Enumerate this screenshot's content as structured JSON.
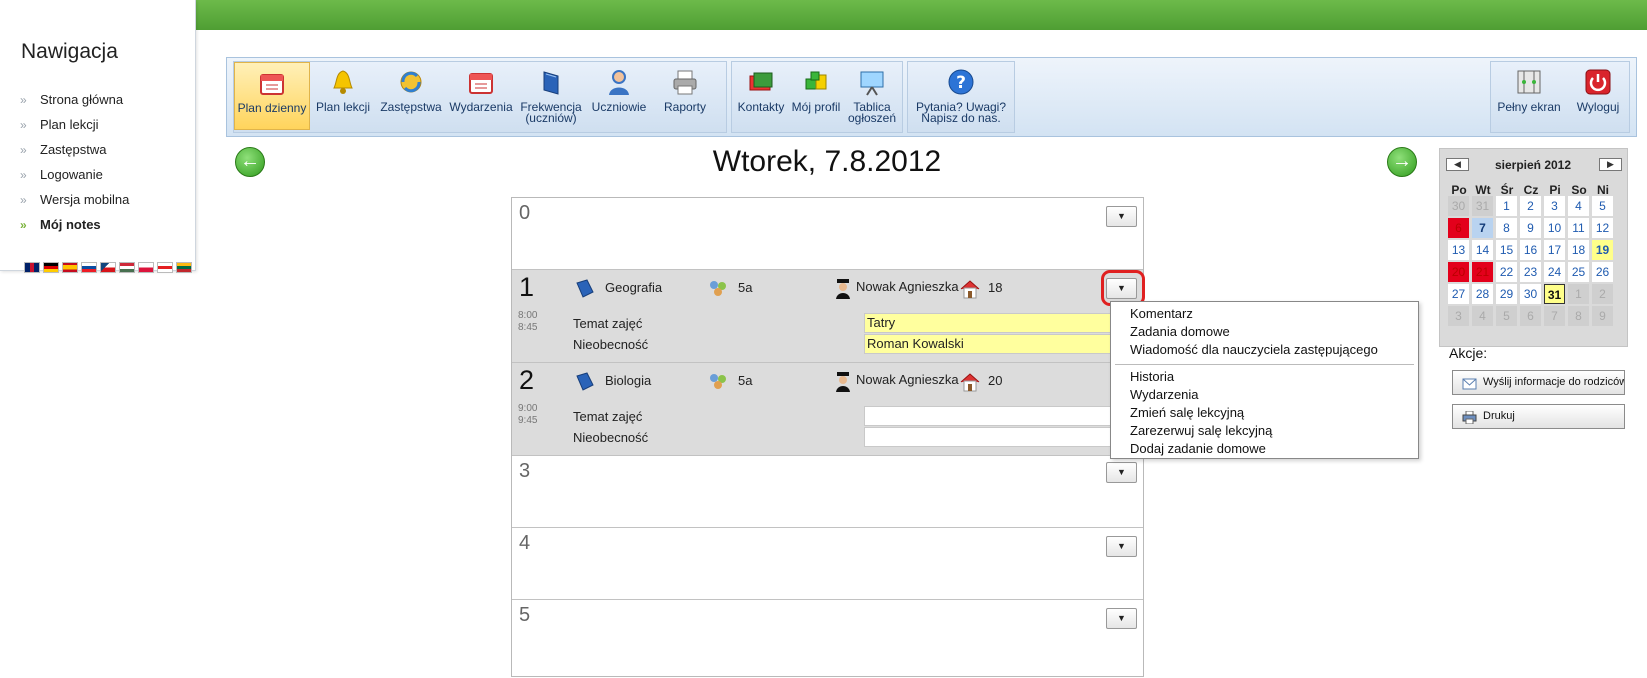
{
  "navigation": {
    "title": "Nawigacja",
    "items": [
      {
        "label": "Strona główna"
      },
      {
        "label": "Plan lekcji"
      },
      {
        "label": "Zastępstwa"
      },
      {
        "label": "Logowanie"
      },
      {
        "label": "Wersja mobilna"
      },
      {
        "label": "Mój notes",
        "active": true
      }
    ],
    "flags": [
      "gb-flag-icon",
      "de-flag-icon",
      "es-flag-icon",
      "sk-flag-icon",
      "cz-flag-icon",
      "hu-flag-icon",
      "pl-flag-icon",
      "al-flag-icon",
      "lt-flag-icon"
    ]
  },
  "toolbar": {
    "group1": [
      {
        "label": "Plan dzienny",
        "icon": "daily-plan-icon",
        "selected": true
      },
      {
        "label": "Plan lekcji",
        "icon": "bell-icon"
      },
      {
        "label": "Zastępstwa",
        "icon": "substitution-icon"
      },
      {
        "label": "Wydarzenia",
        "icon": "events-calendar-icon"
      },
      {
        "label": "Frekwencja (uczniów)",
        "icon": "attendance-book-icon"
      },
      {
        "label": "Uczniowie",
        "icon": "students-icon"
      },
      {
        "label": "Raporty",
        "icon": "printer-icon"
      }
    ],
    "group2": [
      {
        "label": "Kontakty",
        "icon": "contacts-icon"
      },
      {
        "label": "Mój profil",
        "icon": "profile-icon"
      },
      {
        "label": "Tablica ogłoszeń",
        "icon": "board-icon"
      }
    ],
    "group3": [
      {
        "label": "Pytania? Uwagi? Napisz do nas.",
        "icon": "help-icon"
      }
    ],
    "group4": [
      {
        "label": "Pełny ekran",
        "icon": "fullscreen-icon"
      },
      {
        "label": "Wyloguj",
        "icon": "power-icon"
      }
    ]
  },
  "day": {
    "title": "Wtorek, 7.8.2012"
  },
  "schedule": {
    "periods": [
      {
        "number": "0"
      },
      {
        "number": "1",
        "start": "8:00",
        "end": "8:45",
        "subject": "Geografia",
        "class": "5a",
        "teacher": "Nowak Agnieszka",
        "room": "18",
        "topic_label": "Temat zajęć",
        "topic": "Tatry",
        "absence_label": "Nieobecność",
        "absence": "Roman Kowalski"
      },
      {
        "number": "2",
        "start": "9:00",
        "end": "9:45",
        "subject": "Biologia",
        "class": "5a",
        "teacher": "Nowak Agnieszka",
        "room": "20",
        "topic_label": "Temat zajęć",
        "topic": "",
        "absence_label": "Nieobecność",
        "absence": ""
      },
      {
        "number": "3"
      },
      {
        "number": "4"
      },
      {
        "number": "5"
      }
    ]
  },
  "menu": {
    "items": [
      "Komentarz",
      "Zadania domowe",
      "Wiadomość dla nauczyciela zastępującego",
      "Historia",
      "Wydarzenia",
      "Zmień salę lekcyjną",
      "Zarezerwuj salę lekcyjną",
      "Dodaj zadanie domowe"
    ]
  },
  "calendar": {
    "title": "sierpień 2012",
    "weekdays": [
      "Po",
      "Wt",
      "Śr",
      "Cz",
      "Pi",
      "So",
      "Ni"
    ],
    "weeks": [
      [
        "30",
        "31",
        "1",
        "2",
        "3",
        "4",
        "5"
      ],
      [
        "6",
        "7",
        "8",
        "9",
        "10",
        "11",
        "12"
      ],
      [
        "13",
        "14",
        "15",
        "16",
        "17",
        "18",
        "19"
      ],
      [
        "20",
        "21",
        "22",
        "23",
        "24",
        "25",
        "26"
      ],
      [
        "27",
        "28",
        "29",
        "30",
        "31",
        "1",
        "2"
      ],
      [
        "3",
        "4",
        "5",
        "6",
        "7",
        "8",
        "9"
      ]
    ],
    "today": "7",
    "selected": "31",
    "colors": {
      "holiday": "#e3001b",
      "today": "#b9d3f0",
      "highlight": "#ffff8a"
    }
  },
  "actions": {
    "label": "Akcje:",
    "send_label": "Wyślij informacje do rodziców",
    "print_label": "Drukuj"
  }
}
